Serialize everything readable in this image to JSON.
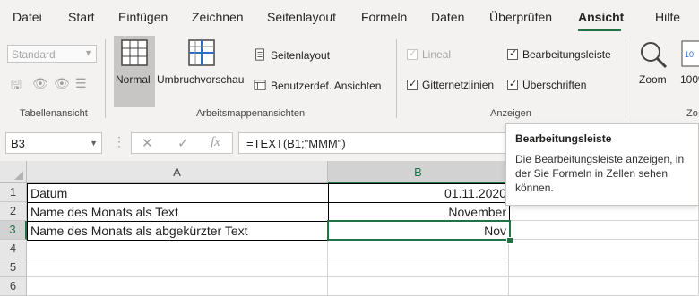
{
  "menu": {
    "tabs": [
      "Datei",
      "Start",
      "Einfügen",
      "Zeichnen",
      "Seitenlayout",
      "Formeln",
      "Daten",
      "Überprüfen",
      "Ansicht",
      "Hilfe"
    ],
    "active_tab": "Ansicht"
  },
  "ribbon": {
    "view_select_value": "Standard",
    "groups": {
      "tabellenansicht": "Tabellenansicht",
      "arbeitsmappenansichten": "Arbeitsmappenansichten",
      "anzeigen": "Anzeigen",
      "zoom_partial": "Zo"
    },
    "buttons": {
      "normal": "Normal",
      "umbruchvorschau": "Umbruchvorschau",
      "seitenlayout": "Seitenlayout",
      "benutzerdef": "Benutzerdef. Ansichten",
      "zoom": "Zoom",
      "zoom100": "100%"
    },
    "checkboxes": {
      "lineal": "Lineal",
      "bearbeitungsleiste": "Bearbeitungsleiste",
      "gitternetzlinien": "Gitternetzlinien",
      "ueberschriften": "Überschriften"
    },
    "zoom_icon_text": "10"
  },
  "formula_bar": {
    "name_box": "B3",
    "cancel_glyph": "✕",
    "enter_glyph": "✓",
    "fx_glyph": "fx",
    "formula": "=TEXT(B1;\"MMM\")"
  },
  "grid": {
    "columns": [
      "A",
      "B"
    ],
    "rows": [
      {
        "num": "1",
        "a": "Datum",
        "b": "01.11.2020"
      },
      {
        "num": "2",
        "a": "Name des Monats als Text",
        "b": "November"
      },
      {
        "num": "3",
        "a": "Name des Monats als abgekürzter Text",
        "b": "Nov"
      },
      {
        "num": "4",
        "a": "",
        "b": ""
      },
      {
        "num": "5",
        "a": "",
        "b": ""
      },
      {
        "num": "6",
        "a": "",
        "b": ""
      }
    ]
  },
  "tooltip": {
    "title": "Bearbeitungsleiste",
    "body": "Die Bearbeitungsleiste anzeigen, in der Sie Formeln in Zellen sehen können."
  },
  "colors": {
    "accent": "#217346",
    "ribbon_bg": "#f3f2f1"
  }
}
